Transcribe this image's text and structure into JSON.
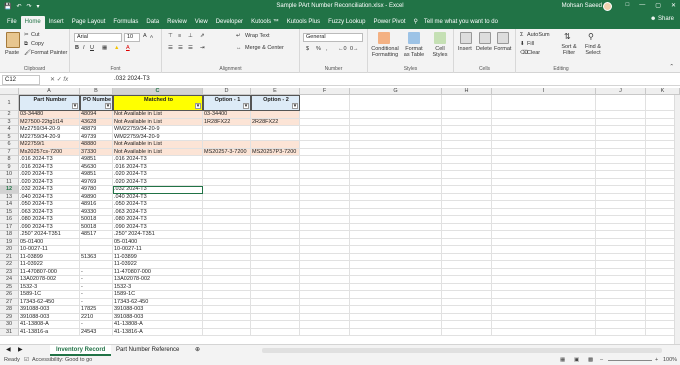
{
  "window": {
    "title": "Sample PArt Number Reconciliation.xlsx  -  Excel",
    "user": "Mohsan Saeed",
    "qa_icons": [
      "save-icon",
      "undo-icon",
      "redo-icon",
      "customize-icon"
    ]
  },
  "ribbon_tabs": [
    "File",
    "Home",
    "Insert",
    "Page Layout",
    "Formulas",
    "Data",
    "Review",
    "View",
    "Developer",
    "Kutools ™",
    "Kutools Plus",
    "Fuzzy Lookup",
    "Power Pivot"
  ],
  "tell_me": "Tell me what you want to do",
  "share": "Share",
  "ribbon": {
    "clipboard": {
      "paste": "Paste",
      "cut": "Cut",
      "copy": "Copy",
      "format_painter": "Format Painter",
      "label": "Clipboard"
    },
    "font": {
      "name": "Arial",
      "size": "10",
      "label": "Font",
      "bold": "B",
      "italic": "I",
      "underline": "U",
      "grow": "A",
      "shrink": "A",
      "color": "A"
    },
    "alignment": {
      "wrap": "Wrap Text",
      "merge": "Merge & Center",
      "label": "Alignment"
    },
    "number": {
      "format": "General",
      "label": "Number",
      "currency": "$",
      "percent": "%",
      "comma": ","
    },
    "styles": {
      "conditional": "Conditional Formatting",
      "table": "Format as Table",
      "cell_styles": "Cell Styles",
      "label": "Styles"
    },
    "cells": {
      "insert": "Insert",
      "delete": "Delete",
      "format": "Format",
      "label": "Cells"
    },
    "editing": {
      "autosum": "AutoSum",
      "fill": "Fill",
      "clear": "Clear",
      "sort": "Sort & Filter",
      "find": "Find & Select",
      "label": "Editing"
    }
  },
  "formula_bar": {
    "cell": "C12",
    "value": ".032 2024-T3"
  },
  "columns": [
    "A",
    "B",
    "C",
    "D",
    "E",
    "F",
    "G",
    "H",
    "I",
    "J",
    "K"
  ],
  "headers": {
    "a": "Part Number",
    "b": "PO Numbe",
    "c": "Matched to",
    "d": "Option - 1",
    "e": "Option - 2"
  },
  "rows": [
    {
      "n": "2",
      "a": "03-34480",
      "b": "48094",
      "c": "Not Available in List",
      "d": "03-34400",
      "e": "",
      "hl": true
    },
    {
      "n": "3",
      "a": "M27500-22tg1t14",
      "b": "43628",
      "c": "Not Available in List",
      "d": "1R28FX22",
      "e": "2R28FX22",
      "hl": true
    },
    {
      "n": "4",
      "a": "Mz2759/34-20-9",
      "b": "48879",
      "c": "WM22759/34-20-9",
      "d": "",
      "e": "",
      "hl": false
    },
    {
      "n": "5",
      "a": "M22759/34-20-9",
      "b": "49739",
      "c": "WM22759/34-20-9",
      "d": "",
      "e": "",
      "hl": false
    },
    {
      "n": "6",
      "a": "M22759/1",
      "b": "48880",
      "c": "Not Available in List",
      "d": "",
      "e": "",
      "hl": true
    },
    {
      "n": "7",
      "a": "Ms20257cs-7200",
      "b": "37330",
      "c": "Not Available in List",
      "d": "MS20257-3-7200",
      "e": "MS20257P3-7200",
      "hl": true
    },
    {
      "n": "8",
      "a": ".016 2024-T3",
      "b": "49851",
      "c": ".016 2024-T3",
      "d": "",
      "e": "",
      "hl": false
    },
    {
      "n": "9",
      "a": ".016 2024-T3",
      "b": "45630",
      "c": ".016 2024-T3",
      "d": "",
      "e": "",
      "hl": false
    },
    {
      "n": "10",
      "a": ".020 2024-T3",
      "b": "49851",
      "c": ".020 2024-T3",
      "d": "",
      "e": "",
      "hl": false
    },
    {
      "n": "11",
      "a": ".020 2024-T3",
      "b": "49769",
      "c": ".020 2024-T3",
      "d": "",
      "e": "",
      "hl": false
    },
    {
      "n": "12",
      "a": ".032 2024-T3",
      "b": "49780",
      "c": ".032 2024-T3",
      "d": "",
      "e": "",
      "hl": false
    },
    {
      "n": "13",
      "a": ".040 2024-T3",
      "b": "49890",
      "c": ".040 2024-T3",
      "d": "",
      "e": "",
      "hl": false
    },
    {
      "n": "14",
      "a": ".050 2024-T3",
      "b": "48916",
      "c": ".050 2024-T3",
      "d": "",
      "e": "",
      "hl": false
    },
    {
      "n": "15",
      "a": ".063 2024-T3",
      "b": "49330",
      "c": ".063 2024-T3",
      "d": "",
      "e": "",
      "hl": false
    },
    {
      "n": "16",
      "a": ".080 2024-T3",
      "b": "50018",
      "c": ".080 2024-T3",
      "d": "",
      "e": "",
      "hl": false
    },
    {
      "n": "17",
      "a": ".090 2024-T3",
      "b": "50018",
      "c": ".090 2024-T3",
      "d": "",
      "e": "",
      "hl": false
    },
    {
      "n": "18",
      "a": ".250\" 2024-T351",
      "b": "48517",
      "c": ".250\" 2024-T351",
      "d": "",
      "e": "",
      "hl": false
    },
    {
      "n": "19",
      "a": "05-01400",
      "b": "",
      "c": "05-01400",
      "d": "",
      "e": "",
      "hl": false
    },
    {
      "n": "20",
      "a": "10-0027-11",
      "b": "",
      "c": "10-0027-11",
      "d": "",
      "e": "",
      "hl": false
    },
    {
      "n": "21",
      "a": "11-03899",
      "b": "51363",
      "c": "11-03899",
      "d": "",
      "e": "",
      "hl": false
    },
    {
      "n": "22",
      "a": "11-03922",
      "b": "",
      "c": "11-03922",
      "d": "",
      "e": "",
      "hl": false
    },
    {
      "n": "23",
      "a": "11-470807-000",
      "b": "-",
      "c": "11-470807-000",
      "d": "",
      "e": "",
      "hl": false
    },
    {
      "n": "24",
      "a": "13A02078-002",
      "b": "-",
      "c": "13A02078-002",
      "d": "",
      "e": "",
      "hl": false
    },
    {
      "n": "25",
      "a": "1532-3",
      "b": "-",
      "c": "1532-3",
      "d": "",
      "e": "",
      "hl": false
    },
    {
      "n": "26",
      "a": "1589-1C",
      "b": "-",
      "c": "1589-1C",
      "d": "",
      "e": "",
      "hl": false
    },
    {
      "n": "27",
      "a": "17343-62-450",
      "b": "-",
      "c": "17343-62-450",
      "d": "",
      "e": "",
      "hl": false
    },
    {
      "n": "28",
      "a": "391088-003",
      "b": "17825",
      "c": "391088-003",
      "d": "",
      "e": "",
      "hl": false
    },
    {
      "n": "29",
      "a": "391088-003",
      "b": "2210",
      "c": "391088-003",
      "d": "",
      "e": "",
      "hl": false
    },
    {
      "n": "30",
      "a": "41-13808-A",
      "b": "-",
      "c": "41-13808-A",
      "d": "",
      "e": "",
      "hl": false
    },
    {
      "n": "31",
      "a": "41-13816-a",
      "b": "24543",
      "c": "41-13816-A",
      "d": "",
      "e": "",
      "hl": false
    }
  ],
  "sheets": [
    "Inventory Record",
    "Part Number Reference"
  ],
  "status": {
    "ready": "Ready",
    "accessibility": "Accessibility: Good to go",
    "zoom": "100%"
  },
  "colors": {
    "excel_green": "#217346",
    "highlight_row": "#fce4d6",
    "header_yellow": "#ffff00",
    "header_blue": "#ddebf7",
    "selection": "#217346"
  }
}
